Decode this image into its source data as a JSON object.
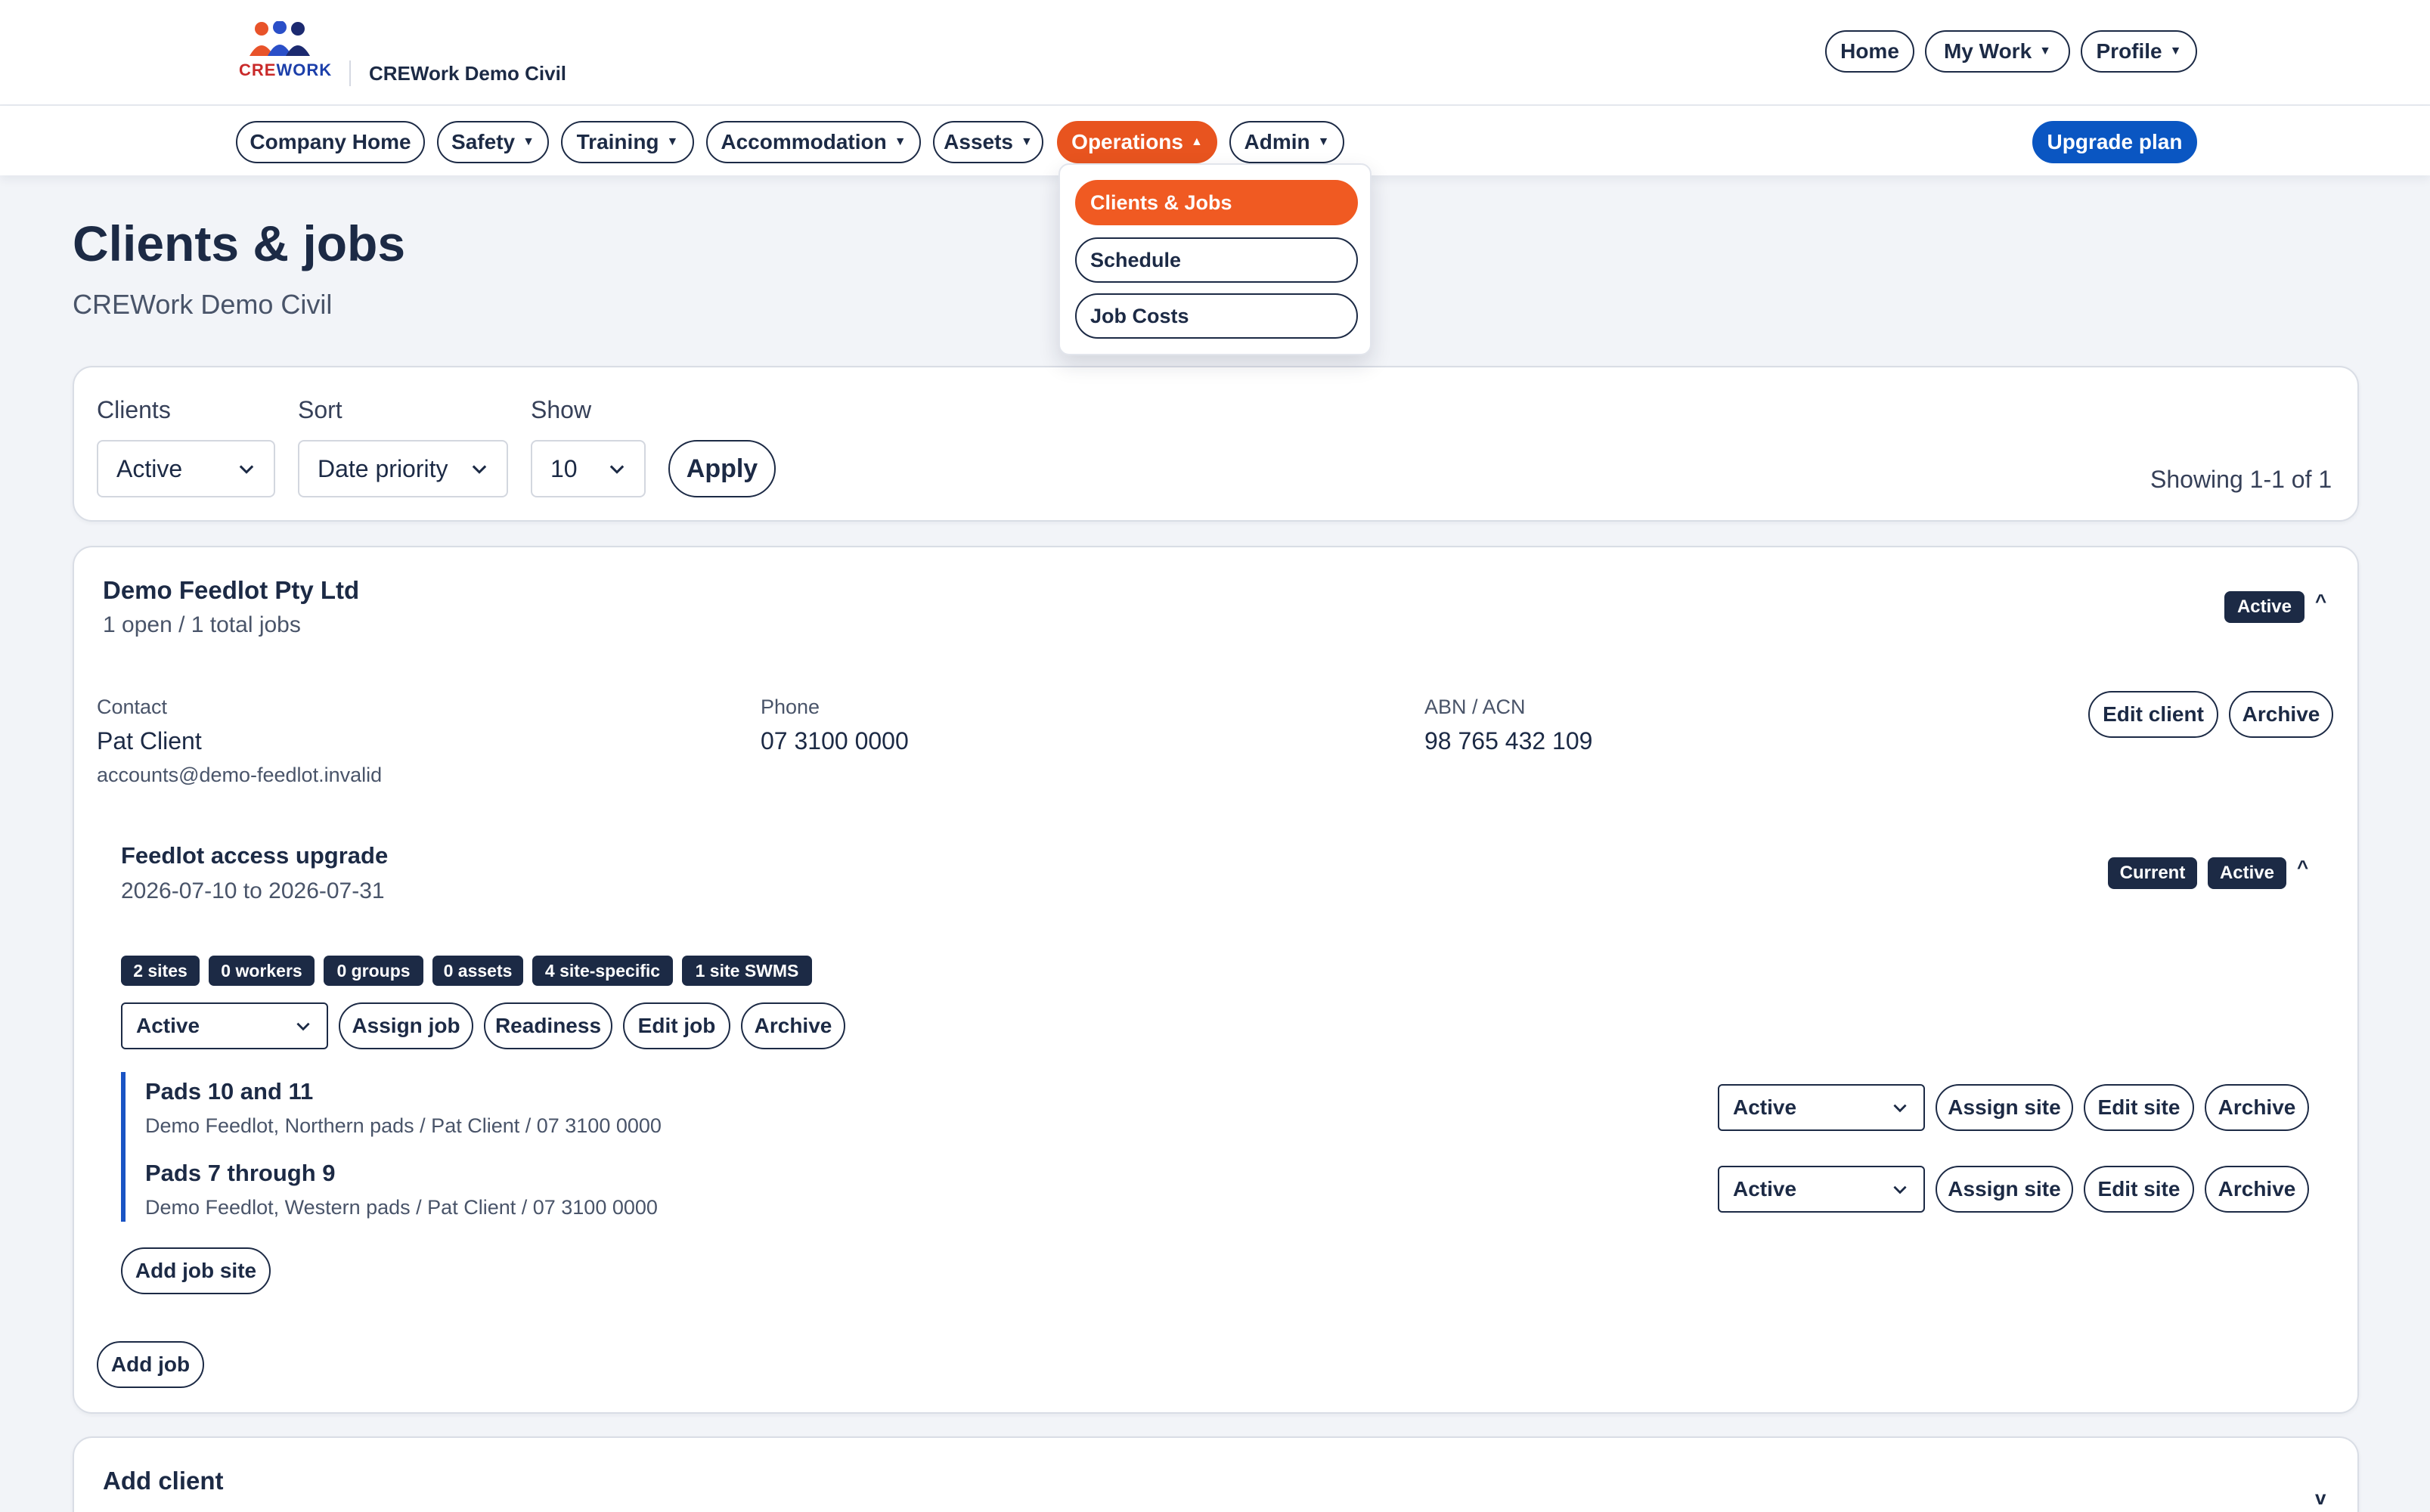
{
  "brand": {
    "logo_word_1": "CRE",
    "logo_word_2": "WORK",
    "company": "CREWork Demo Civil"
  },
  "top_nav": {
    "home": "Home",
    "my_work": "My Work",
    "profile": "Profile"
  },
  "main_nav": {
    "company_home": "Company Home",
    "safety": "Safety",
    "training": "Training",
    "accommodation": "Accommodation",
    "assets": "Assets",
    "operations": "Operations",
    "admin": "Admin",
    "upgrade": "Upgrade plan"
  },
  "operations_menu": {
    "items": [
      "Clients & Jobs",
      "Schedule",
      "Job Costs"
    ],
    "selected": "Clients & Jobs"
  },
  "page": {
    "title": "Clients & jobs",
    "subtitle": "CREWork Demo Civil"
  },
  "filters": {
    "clients_label": "Clients",
    "clients_value": "Active",
    "sort_label": "Sort",
    "sort_value": "Date priority",
    "show_label": "Show",
    "show_value": "10",
    "apply": "Apply",
    "showing": "Showing 1-1 of 1"
  },
  "client": {
    "name": "Demo Feedlot Pty Ltd",
    "summary": "1 open / 1 total jobs",
    "status": "Active",
    "contact_label": "Contact",
    "contact_name": "Pat Client",
    "contact_email": "accounts@demo-feedlot.invalid",
    "phone_label": "Phone",
    "phone": "07 3100 0000",
    "abn_label": "ABN / ACN",
    "abn": "98 765 432 109",
    "edit": "Edit client",
    "archive": "Archive",
    "add_job": "Add job"
  },
  "job": {
    "name": "Feedlot access upgrade",
    "dates": "2026-07-10 to 2026-07-31",
    "badge_current": "Current",
    "badge_status": "Active",
    "chips": [
      "2 sites",
      "0 workers",
      "0 groups",
      "0 assets",
      "4 site-specific",
      "1 site SWMS"
    ],
    "status_value": "Active",
    "assign": "Assign job",
    "readiness": "Readiness",
    "edit": "Edit job",
    "archive": "Archive",
    "add_site": "Add job site"
  },
  "sites": [
    {
      "name": "Pads 10 and 11",
      "detail": "Demo Feedlot, Northern pads / Pat Client / 07 3100 0000",
      "status": "Active",
      "assign": "Assign site",
      "edit": "Edit site",
      "archive": "Archive"
    },
    {
      "name": "Pads 7 through 9",
      "detail": "Demo Feedlot, Western pads / Pat Client / 07 3100 0000",
      "status": "Active",
      "assign": "Assign site",
      "edit": "Edit site",
      "archive": "Archive"
    }
  ],
  "add_client": {
    "title": "Add client",
    "expand": "v"
  },
  "colors": {
    "navy": "#1c2a45",
    "orange": "#e8541f",
    "blue": "#0a56c2",
    "site_bar": "#1a54c4"
  },
  "icons": {
    "caret": "caret-down-icon",
    "chevron": "chevron-down-icon",
    "collapse": "chevron-up-icon"
  }
}
